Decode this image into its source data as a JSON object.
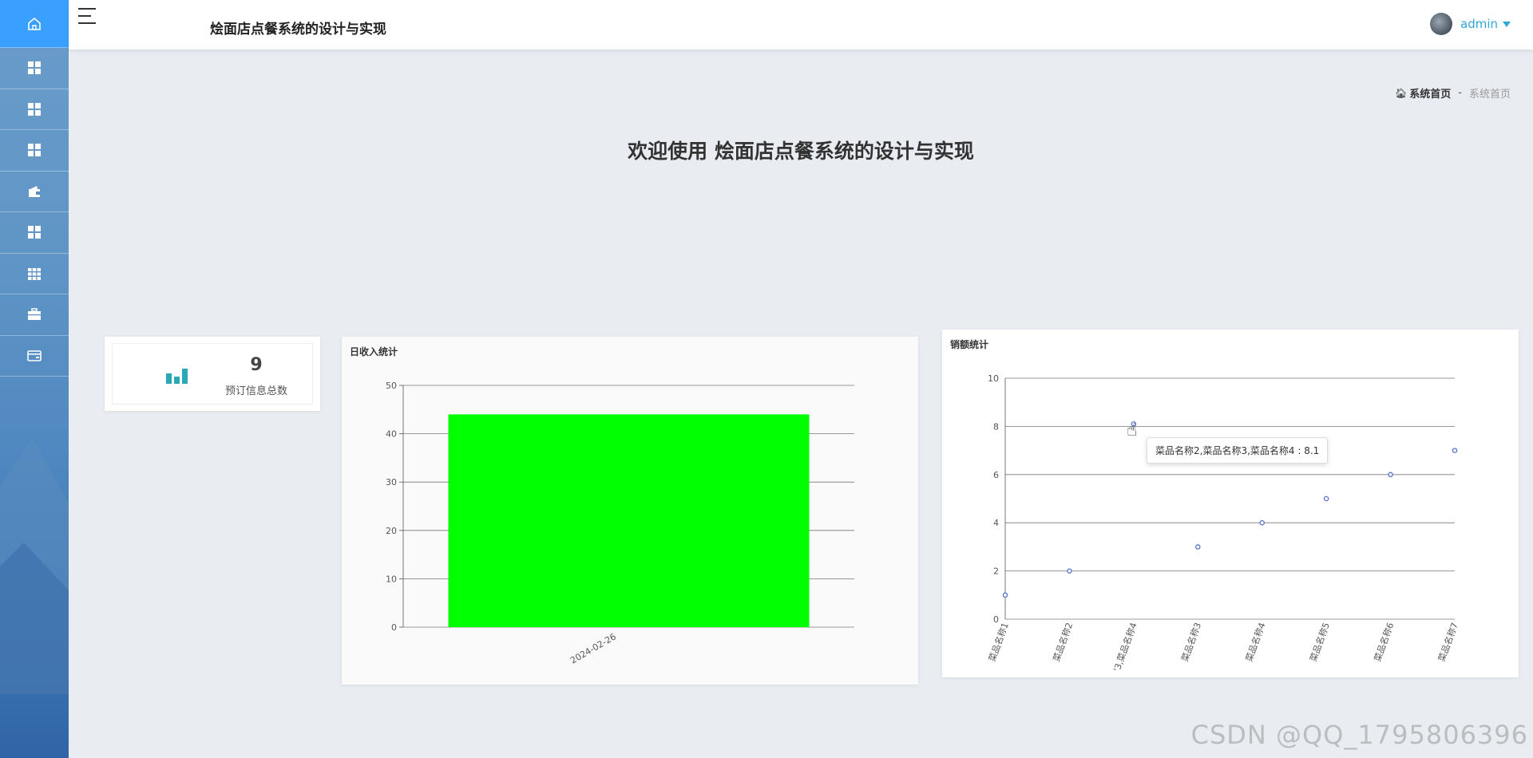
{
  "header": {
    "app_title": "烩面店点餐系统的设计与实现",
    "user_name": "admin"
  },
  "sidebar": {
    "items": [
      {
        "icon": "home-icon"
      },
      {
        "icon": "grid-icon"
      },
      {
        "icon": "grid-icon"
      },
      {
        "icon": "grid-icon"
      },
      {
        "icon": "wallet-icon"
      },
      {
        "icon": "grid-icon"
      },
      {
        "icon": "table-icon"
      },
      {
        "icon": "briefcase-icon"
      },
      {
        "icon": "card-icon"
      }
    ]
  },
  "breadcrumb": {
    "home": "系统首页",
    "separator": "-",
    "current": "系统首页"
  },
  "welcome": "欢迎使用 烩面店点餐系统的设计与实现",
  "stat": {
    "value": "9",
    "label": "预订信息总数"
  },
  "tooltip": "菜品名称2,菜品名称3,菜品名称4 : 8.1",
  "watermark": "CSDN @QQ_1795806396",
  "colors": {
    "accent": "#3aa0ff",
    "bar": "#00ff00",
    "point": "#5470c6"
  },
  "chart_data": [
    {
      "type": "bar",
      "title": "日收入统计",
      "categories": [
        "2024-02-26"
      ],
      "values": [
        44
      ],
      "ylim": [
        0,
        50
      ],
      "yticks": [
        0,
        10,
        20,
        30,
        40,
        50
      ],
      "grid": true
    },
    {
      "type": "scatter",
      "title": "销额统计",
      "categories": [
        "菜品名称1",
        "菜品名称2",
        "菜品名称2,菜品名称3,菜品名称4",
        "菜品名称3",
        "菜品名称4",
        "菜品名称5",
        "菜品名称6",
        "菜品名称7"
      ],
      "category_tick_labels": [
        "菜品名称1",
        "菜品名称2",
        "'3,菜品名称4",
        "菜品名称3",
        "菜品名称4",
        "菜品名称5",
        "菜品名称6",
        "菜品名称7"
      ],
      "values": [
        1,
        2,
        8.1,
        3,
        4,
        5,
        6,
        7
      ],
      "ylim": [
        0,
        10
      ],
      "yticks": [
        0,
        2,
        4,
        6,
        8,
        10
      ],
      "grid": true
    }
  ]
}
